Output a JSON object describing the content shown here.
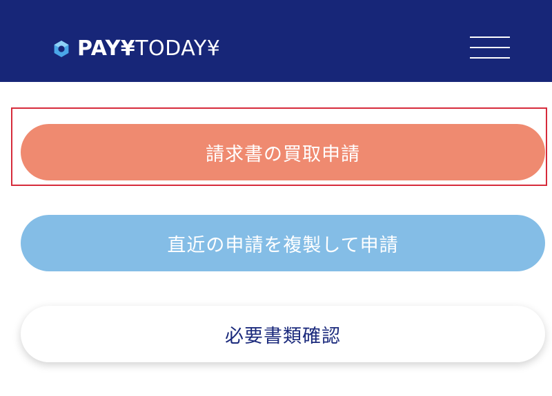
{
  "colors": {
    "header_bg": "#172678",
    "purchase_button_bg": "#ef8a70",
    "duplicate_button_bg": "#84bde6",
    "docs_button_text": "#1b2a7c",
    "highlight_border": "#d62a3a"
  },
  "header": {
    "logo": {
      "icon": "payday-logo-mark-icon",
      "text_bold": "PAY¥",
      "text_light": "TODAY¥"
    },
    "menu_icon": "hamburger-menu-icon"
  },
  "actions": {
    "purchase_request_label": "請求書の買取申請",
    "duplicate_request_label": "直近の申請を複製して申請",
    "check_documents_label": "必要書類確認"
  }
}
